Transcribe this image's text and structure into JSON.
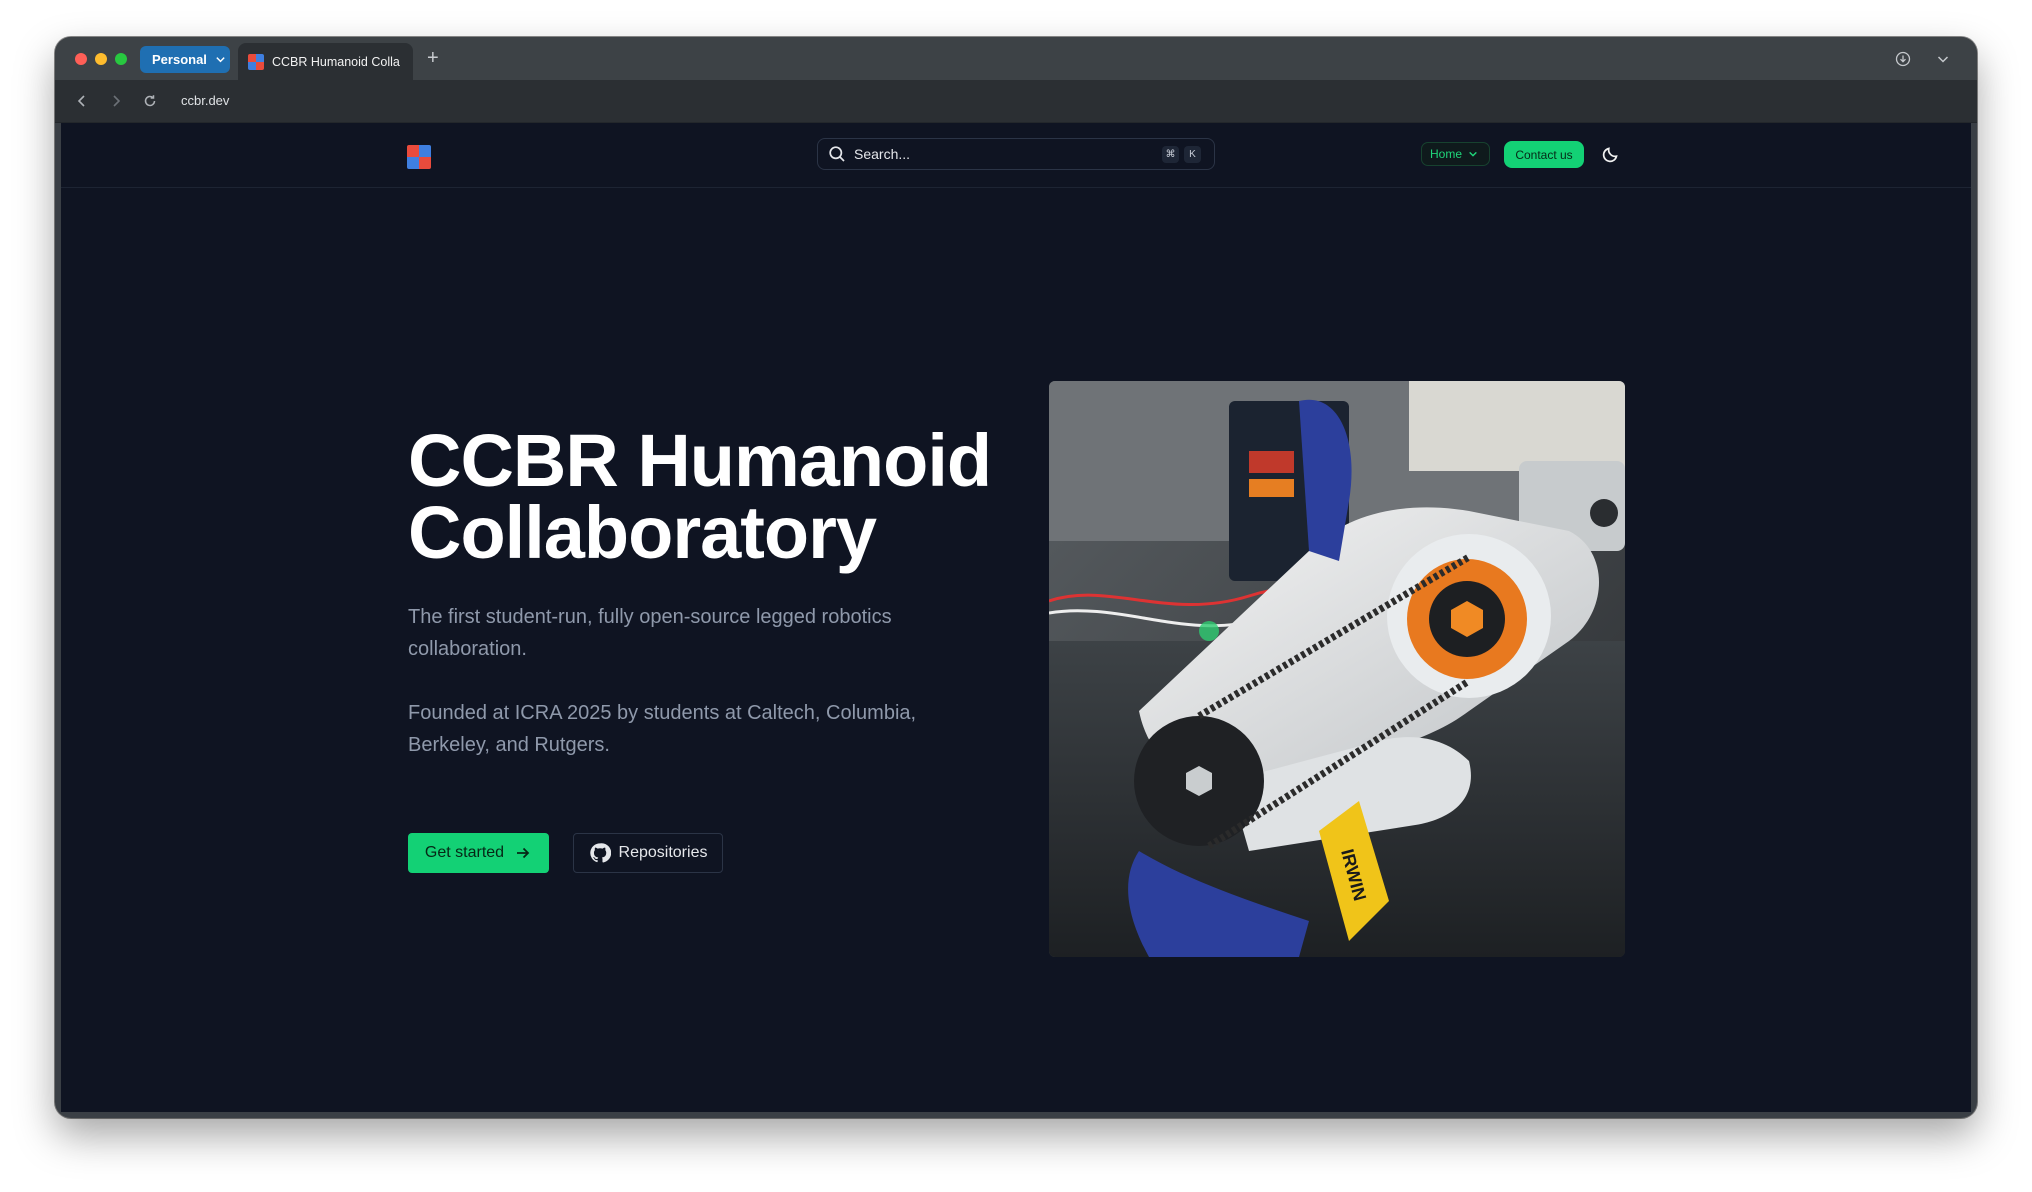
{
  "browser": {
    "profile_label": "Personal",
    "active_tab_title": "CCBR Humanoid Collaboratory",
    "new_tab_symbol": "+",
    "url": "ccbr.dev"
  },
  "site": {
    "search_placeholder": "Search...",
    "search_shortcut_keys": [
      "⌘",
      "K"
    ],
    "nav_home_label": "Home",
    "contact_label": "Contact us"
  },
  "hero": {
    "title_line1": "CCBR Humanoid",
    "title_line2": "Collaboratory",
    "paragraph1": "The first student-run, fully open-source legged robotics collaboration.",
    "paragraph2": "Founded at ICRA 2025 by students at Caltech, Columbia, Berkeley, and Rutgers.",
    "primary_button": "Get started",
    "secondary_button": "Repositories",
    "image_clamp_text": "IRWIN"
  },
  "colors": {
    "page_bg": "#0f1422",
    "accent_green": "#13d175",
    "muted_text": "#8f99ab",
    "profile_blue": "#1f6fb2"
  },
  "icons": [
    "search-icon",
    "chevron-down-icon",
    "moon-icon",
    "arrow-right-icon",
    "github-icon",
    "back-icon",
    "forward-icon",
    "reload-icon",
    "download-icon"
  ]
}
